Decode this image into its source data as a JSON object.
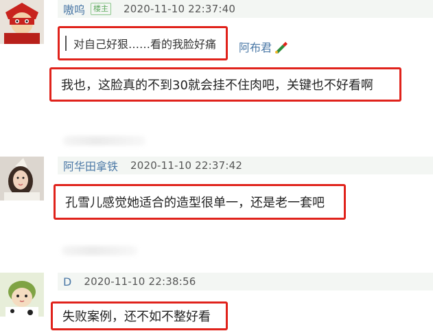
{
  "comments": [
    {
      "username": "嗷呜",
      "badge": "楼主",
      "timestamp": "2020-11-10 22:37:40",
      "quote": {
        "text": "对自己好狠……看的我脸好痛",
        "author": "阿布君"
      },
      "reply": "我也，这脸真的不到30就会挂不住肉吧，关键也不好看啊"
    },
    {
      "username": "阿华田拿铁",
      "timestamp": "2020-11-10 22:37:42",
      "text": "孔雪儿感觉她适合的造型很单一，还是老一套吧"
    },
    {
      "username": "D",
      "timestamp": "2020-11-10 22:38:56",
      "text": "失败案例，还不如不整好看"
    }
  ],
  "colors": {
    "highlight": "#e0221b",
    "username": "#4b78a6",
    "meta_bg": "#f3f6f3"
  }
}
